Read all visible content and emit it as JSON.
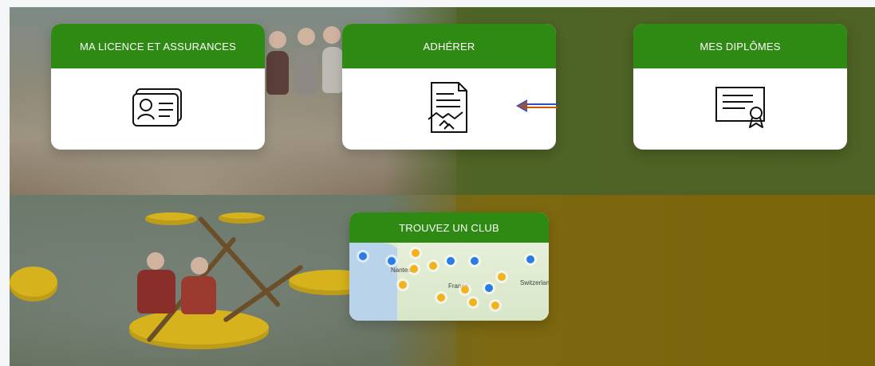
{
  "cards": {
    "licence": {
      "title": "MA LICENCE ET ASSURANCES",
      "icon": "id-card-icon"
    },
    "adherer": {
      "title": "ADHÉRER",
      "icon": "contract-handshake-icon"
    },
    "diplomes": {
      "title": "MES DIPLÔMES",
      "icon": "certificate-icon"
    }
  },
  "club_finder": {
    "title": "TROUVEZ UN CLUB",
    "map": {
      "labels": [
        "Nantes",
        "France",
        "Switzerland"
      ]
    }
  },
  "annotations": {
    "arrow": "left-arrow-icon"
  },
  "colors": {
    "card_header_green": "#2f8a14",
    "marker_orange": "#f2b21b",
    "marker_blue": "#2a7be4",
    "arrow_orange": "#d35400",
    "arrow_blue": "#2d4fbf"
  }
}
